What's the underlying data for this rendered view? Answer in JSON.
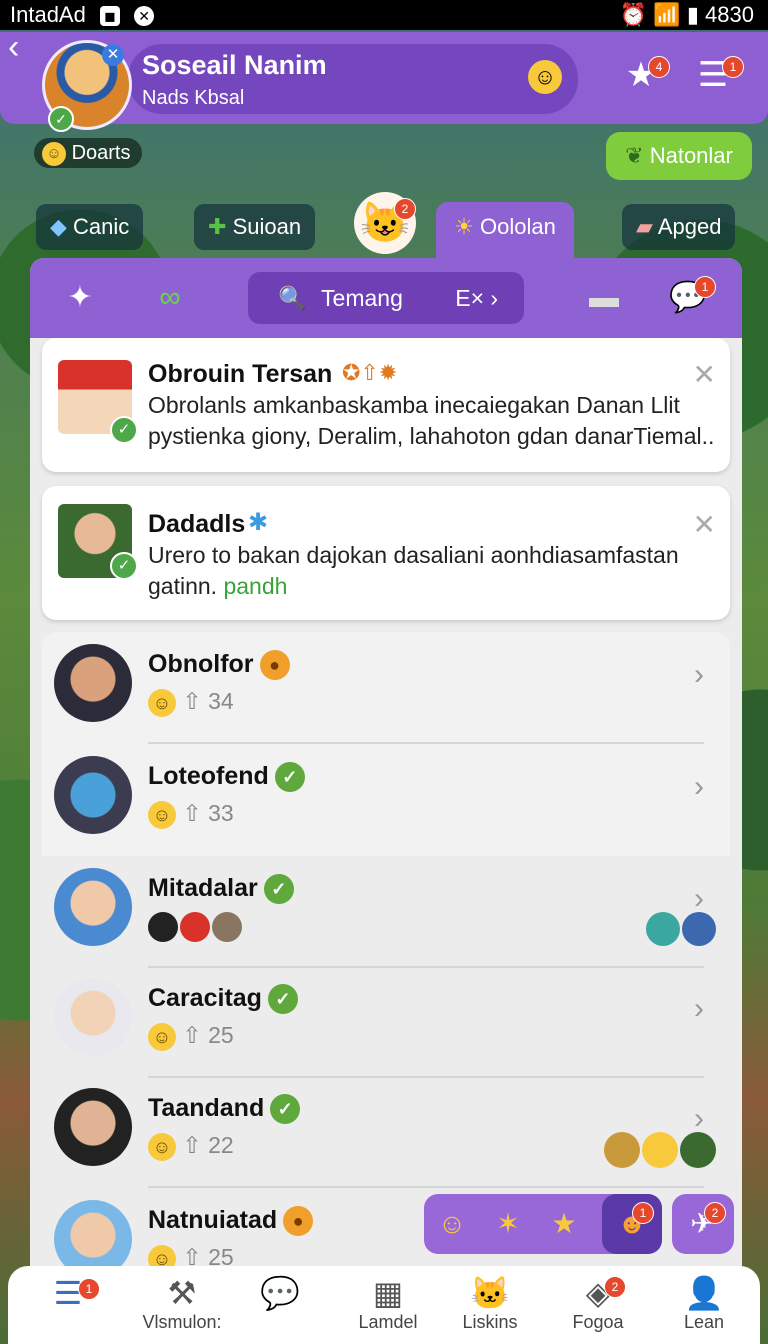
{
  "status": {
    "left": "IntadAd",
    "time": "4830"
  },
  "header": {
    "title": "Soseail Nanim",
    "subtitle": "Nads Kbsal",
    "star_badge": "4",
    "menu_badge": "1"
  },
  "chips": {
    "doarts": "Doarts",
    "natonlar": "Natonlar"
  },
  "tabs": [
    {
      "label": "Canic"
    },
    {
      "label": "Suioan"
    },
    {
      "label": "Oololan"
    },
    {
      "label": "Apged"
    }
  ],
  "mascot_badge": "2",
  "toolbar": {
    "search_text": "Temang",
    "search_ext": "E×",
    "chat_badge": "1"
  },
  "notifications": [
    {
      "name": "Obrouin Tersan",
      "message": "Obrolanls amkanbaskamba inecaiegakan Danan Llit pystienka giony, Deralim, lahahoton gdan danarTiemal.."
    },
    {
      "name": "Dadadls",
      "message": "Urero to bakan dajokan dasaliani aonhdiasamfastan gatinn.",
      "link": "pandh"
    }
  ],
  "rows": [
    {
      "name": "Obnolfor",
      "count": "34"
    },
    {
      "name": "Loteofend",
      "count": "33"
    },
    {
      "name": "Mitadalar",
      "count": ""
    },
    {
      "name": "Caracitag",
      "count": "25"
    },
    {
      "name": "Taandand",
      "count": "22"
    },
    {
      "name": "Natnuiatad",
      "count": "25"
    }
  ],
  "react_badges": {
    "face": "1",
    "side": "2"
  },
  "bottom_nav": [
    {
      "label": "",
      "badge": "1"
    },
    {
      "label": "Vlsmulon:"
    },
    {
      "label": ""
    },
    {
      "label": "Lamdel"
    },
    {
      "label": "Liskins"
    },
    {
      "label": "Fogoa",
      "badge": "2"
    },
    {
      "label": "Lean"
    }
  ]
}
